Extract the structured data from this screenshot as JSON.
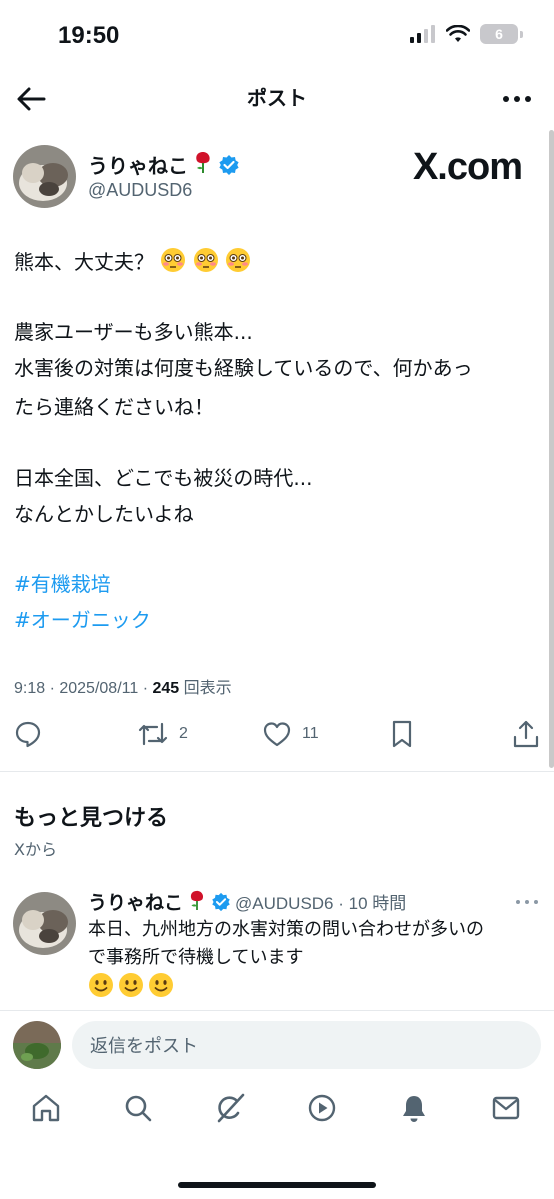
{
  "status_bar": {
    "time": "19:50",
    "battery": "6"
  },
  "header": {
    "title": "ポスト"
  },
  "post": {
    "author_name": "うりゃねこ",
    "author_handle": "@AUDUSD6",
    "watermark": "X.com",
    "body_lines": [
      "熊本、大丈夫？",
      "農家ユーザーも多い熊本...",
      "水害後の対策は何度も経験しているので、何かあっ",
      "たら連絡くださいね！",
      "日本全国、どこでも被災の時代...",
      "なんとかしたいよね"
    ],
    "hashtags": [
      "#有機栽培",
      "#オーガニック"
    ],
    "meta_time": "9:18 · 2025/08/11 · ",
    "views": "245",
    "views_label": " 回表示",
    "actions": {
      "retweets": "2",
      "likes": "11"
    }
  },
  "discover": {
    "title": "もっと見つける",
    "subtitle": "Xから",
    "related": {
      "author_name": "うりゃねこ",
      "meta": "@AUDUSD6 · 10 時間",
      "lines": [
        "本日、九州地方の水害対策の問い合わせが多いの",
        "で事務所で待機しています"
      ]
    }
  },
  "reply": {
    "placeholder": "返信をポスト"
  },
  "colors": {
    "accent": "#1d9bf0",
    "text": "#0f1419",
    "muted": "#536471"
  },
  "icons": [
    "back-arrow-icon",
    "more-icon",
    "verified-badge-icon",
    "rose-emoji",
    "flushed-face-emoji",
    "slightly-smiling-face-emoji",
    "reply-icon",
    "retweet-icon",
    "like-icon",
    "bookmark-icon",
    "share-icon",
    "home-icon",
    "search-icon",
    "grok-icon",
    "video-icon",
    "notifications-icon",
    "messages-icon"
  ]
}
